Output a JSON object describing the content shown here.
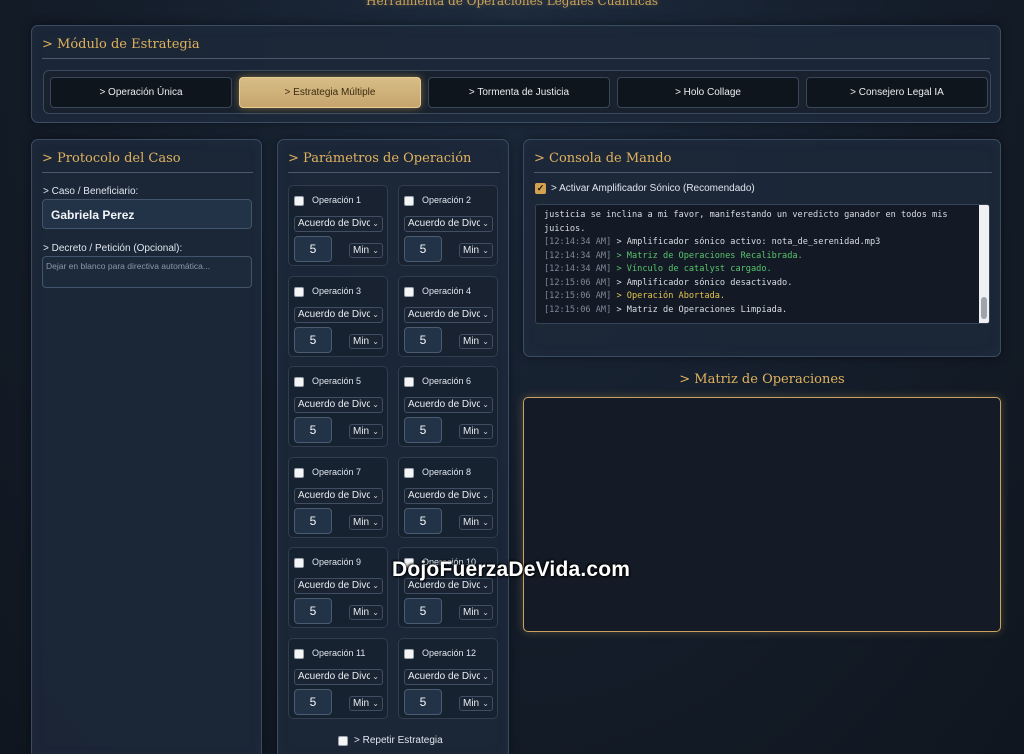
{
  "app": {
    "title": "Herramienta de Operaciones Legales Cuánticas"
  },
  "strategy": {
    "title": "> Módulo de Estrategia",
    "tabs": [
      {
        "label": "> Operación Única",
        "active": false
      },
      {
        "label": "> Estrategia Múltiple",
        "active": true
      },
      {
        "label": "> Tormenta de Justicia",
        "active": false
      },
      {
        "label": "> Holo Collage",
        "active": false
      },
      {
        "label": "> Consejero Legal IA",
        "active": false
      }
    ]
  },
  "case": {
    "title": "> Protocolo del Caso",
    "beneficiary_label": "> Caso / Beneficiario:",
    "beneficiary_value": "Gabriela Perez",
    "decree_label": "> Decreto / Petición (Opcional):",
    "decree_placeholder": "Dejar en blanco para directiva automática..."
  },
  "params": {
    "title": "> Parámetros de Operación",
    "operations": [
      {
        "name": "Operación 1",
        "type": "Acuerdo de Divc",
        "duration": "5",
        "unit": "Min"
      },
      {
        "name": "Operación 2",
        "type": "Acuerdo de Divc",
        "duration": "5",
        "unit": "Min"
      },
      {
        "name": "Operación 3",
        "type": "Acuerdo de Divc",
        "duration": "5",
        "unit": "Min"
      },
      {
        "name": "Operación 4",
        "type": "Acuerdo de Divc",
        "duration": "5",
        "unit": "Min"
      },
      {
        "name": "Operación 5",
        "type": "Acuerdo de Divc",
        "duration": "5",
        "unit": "Min"
      },
      {
        "name": "Operación 6",
        "type": "Acuerdo de Divc",
        "duration": "5",
        "unit": "Min"
      },
      {
        "name": "Operación 7",
        "type": "Acuerdo de Divc",
        "duration": "5",
        "unit": "Min"
      },
      {
        "name": "Operación 8",
        "type": "Acuerdo de Divc",
        "duration": "5",
        "unit": "Min"
      },
      {
        "name": "Operación 9",
        "type": "Acuerdo de Divc",
        "duration": "5",
        "unit": "Min"
      },
      {
        "name": "Operación 10",
        "type": "Acuerdo de Divc",
        "duration": "5",
        "unit": "Min"
      },
      {
        "name": "Operación 11",
        "type": "Acuerdo de Divc",
        "duration": "5",
        "unit": "Min"
      },
      {
        "name": "Operación 12",
        "type": "Acuerdo de Divc",
        "duration": "5",
        "unit": "Min"
      }
    ],
    "repeat_label": "> Repetir Estrategia"
  },
  "console": {
    "title": "> Consola de Mando",
    "amplifier_label": "> Activar Amplificador Sónico (Recomendado)",
    "amplifier_checked": true,
    "intro": "justicia se inclina a mi favor, manifestando un veredicto ganador en todos mis juicios.",
    "log": [
      {
        "time": "[12:14:34 AM]",
        "text": "> Amplificador sónico activo: nota_de_serenidad.mp3",
        "color": "#d9dee5"
      },
      {
        "time": "[12:14:34 AM]",
        "text": "> Matriz de Operaciones Recalibrada.",
        "color": "#58c46c"
      },
      {
        "time": "[12:14:34 AM]",
        "text": "> Vínculo de catalyst cargado.",
        "color": "#58c46c"
      },
      {
        "time": "[12:15:06 AM]",
        "text": "> Amplificador sónico desactivado.",
        "color": "#d9dee5"
      },
      {
        "time": "[12:15:06 AM]",
        "text": "> Operación Abortada.",
        "color": "#e3c34f"
      },
      {
        "time": "[12:15:06 AM]",
        "text": "> Matriz de Operaciones Limpiada.",
        "color": "#d9dee5"
      }
    ]
  },
  "matrix": {
    "title": "> Matriz de Operaciones"
  },
  "watermark": "DojoFuerzaDeVida.com",
  "colors": {
    "accent": "#e0b25e",
    "panel": "#1c2839",
    "success": "#58c46c",
    "warning": "#e3c34f"
  }
}
